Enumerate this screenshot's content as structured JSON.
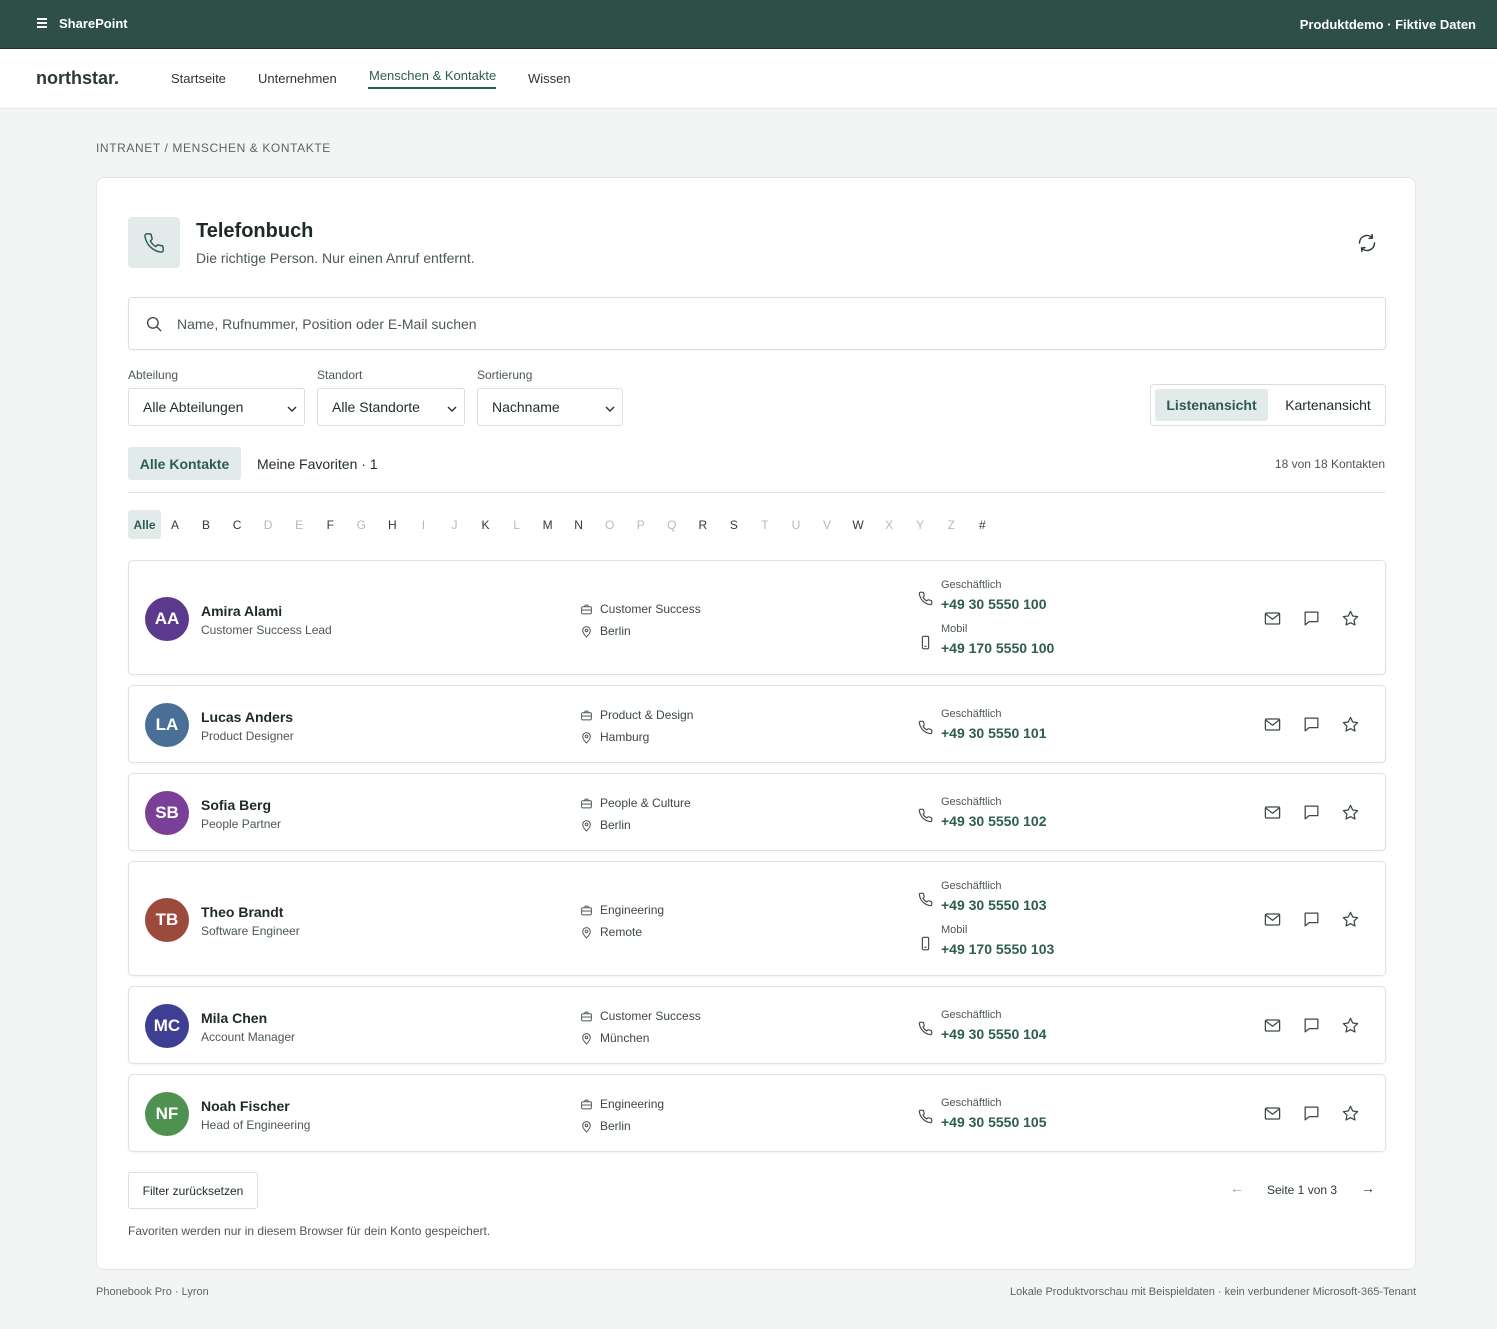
{
  "topbar": {
    "brand": "SharePoint",
    "right": "Produktdemo · Fiktive Daten"
  },
  "nav": {
    "logo": "northstar.",
    "links": [
      "Startseite",
      "Unternehmen",
      "Menschen & Kontakte",
      "Wissen"
    ],
    "active": "Menschen & Kontakte"
  },
  "breadcrumb": "INTRANET / MENSCHEN & KONTAKTE",
  "header": {
    "title": "Telefonbuch",
    "subtitle": "Die richtige Person. Nur einen Anruf entfernt."
  },
  "search": {
    "placeholder": "Name, Rufnummer, Position oder E-Mail suchen",
    "value": ""
  },
  "filters": {
    "department": {
      "label": "Abteilung",
      "value": "Alle Abteilungen"
    },
    "location": {
      "label": "Standort",
      "value": "Alle Standorte"
    },
    "sort": {
      "label": "Sortierung",
      "value": "Nachname"
    }
  },
  "view": {
    "list": "Listenansicht",
    "cards": "Kartenansicht",
    "active": "Listenansicht"
  },
  "tabs": {
    "all": "Alle Kontakte",
    "favorites": "Meine Favoriten · 1"
  },
  "count": "18 von 18 Kontakten",
  "alphabet": {
    "all": "Alle",
    "letters": [
      "A",
      "B",
      "C",
      "D",
      "E",
      "F",
      "G",
      "H",
      "I",
      "J",
      "K",
      "L",
      "M",
      "N",
      "O",
      "P",
      "Q",
      "R",
      "S",
      "T",
      "U",
      "V",
      "W",
      "X",
      "Y",
      "Z",
      "#"
    ],
    "available": [
      "A",
      "B",
      "C",
      "F",
      "H",
      "K",
      "M",
      "N",
      "R",
      "S",
      "W",
      "#"
    ]
  },
  "contacts": [
    {
      "initials": "AA",
      "name": "Amira Alami",
      "role": "Customer Success Lead",
      "department": "Customer Success",
      "location": "Berlin",
      "business_label": "Geschäftlich",
      "business": "+49 30 5550 100",
      "mobile_label": "Mobil",
      "mobile": "+49 170 5550 100",
      "color": "#5b3a8e"
    },
    {
      "initials": "LA",
      "name": "Lucas Anders",
      "role": "Product Designer",
      "department": "Product & Design",
      "location": "Hamburg",
      "business_label": "Geschäftlich",
      "business": "+49 30 5550 101",
      "color": "#4a6f96"
    },
    {
      "initials": "SB",
      "name": "Sofia Berg",
      "role": "People Partner",
      "department": "People & Culture",
      "location": "Berlin",
      "business_label": "Geschäftlich",
      "business": "+49 30 5550 102",
      "color": "#7a3f96"
    },
    {
      "initials": "TB",
      "name": "Theo Brandt",
      "role": "Software Engineer",
      "department": "Engineering",
      "location": "Remote",
      "business_label": "Geschäftlich",
      "business": "+49 30 5550 103",
      "mobile_label": "Mobil",
      "mobile": "+49 170 5550 103",
      "color": "#9c4a3c"
    },
    {
      "initials": "MC",
      "name": "Mila Chen",
      "role": "Account Manager",
      "department": "Customer Success",
      "location": "München",
      "business_label": "Geschäftlich",
      "business": "+49 30 5550 104",
      "color": "#3e3f94"
    },
    {
      "initials": "NF",
      "name": "Noah Fischer",
      "role": "Head of Engineering",
      "department": "Engineering",
      "location": "Berlin",
      "business_label": "Geschäftlich",
      "business": "+49 30 5550 105",
      "color": "#4f9150"
    }
  ],
  "footer_actions": {
    "reset": "Filter zurücksetzen",
    "page": "Seite 1 von 3",
    "prev": "←",
    "next": "→"
  },
  "note": "Favoriten werden nur in diesem Browser für dein Konto gespeichert.",
  "footer": {
    "left": "Phonebook Pro · Lyron",
    "right": "Lokale Produktvorschau mit Beispieldaten · kein verbundener Microsoft-365-Tenant"
  },
  "colors": {
    "topbar": "#2e4e48",
    "accent": "#2e5c52",
    "accent_soft": "#e2ebe9"
  }
}
